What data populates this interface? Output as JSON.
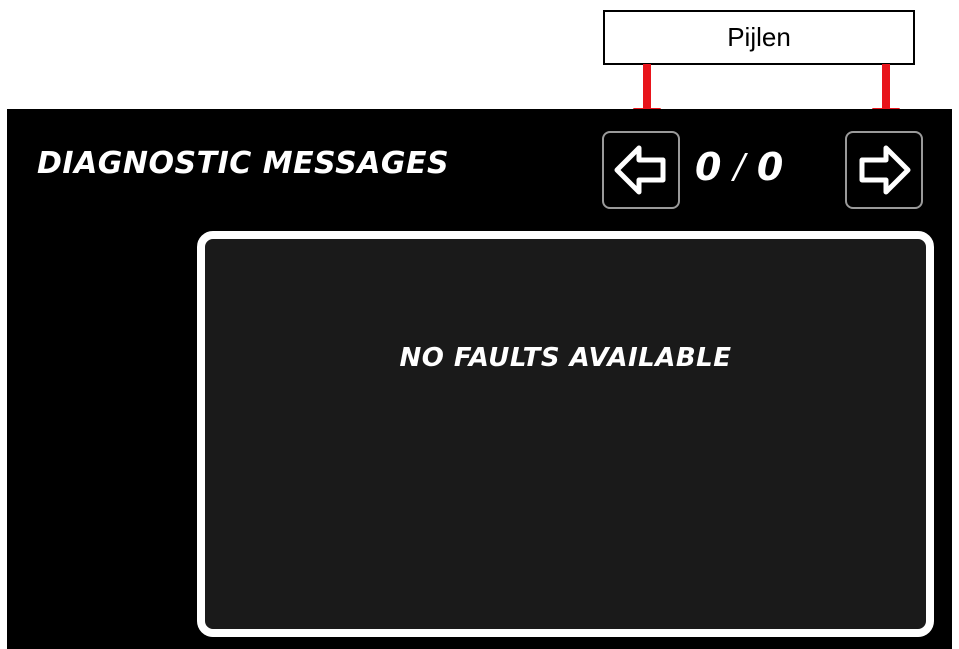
{
  "callout": {
    "label": "Pijlen",
    "arrow_color": "#e8141b"
  },
  "screen": {
    "title": "DIAGNOSTIC MESSAGES",
    "counter": {
      "current": "0",
      "separator": "/",
      "total": "0"
    },
    "prev_button": {
      "icon": "arrow-left-icon"
    },
    "next_button": {
      "icon": "arrow-right-icon"
    },
    "message": "NO FAULTS AVAILABLE"
  },
  "colors": {
    "screen_bg": "#000000",
    "panel_bg": "#1a1a1a",
    "panel_border": "#ffffff",
    "button_border": "#9a9a9a",
    "text": "#ffffff"
  }
}
